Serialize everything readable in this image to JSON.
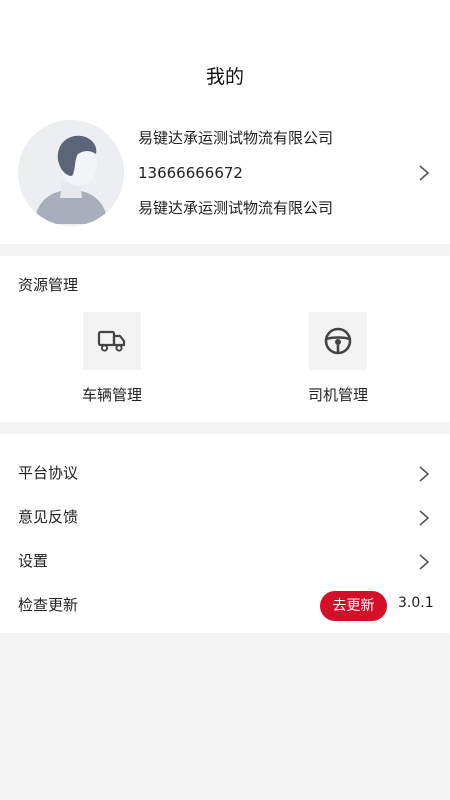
{
  "header": {
    "title": "我的"
  },
  "profile": {
    "company_name": "易键达承运测试物流有限公司",
    "phone": "13666666672",
    "company_subtitle": "易键达承运测试物流有限公司"
  },
  "resources": {
    "section_title": "资源管理",
    "items": [
      {
        "label": "车辆管理",
        "icon": "truck-icon"
      },
      {
        "label": "司机管理",
        "icon": "steering-wheel-icon"
      }
    ]
  },
  "menu": {
    "items": [
      {
        "label": "平台协议"
      },
      {
        "label": "意见反馈"
      },
      {
        "label": "设置"
      }
    ],
    "check_update": {
      "label": "检查更新",
      "button_label": "去更新",
      "version": "3.0.1"
    }
  },
  "colors": {
    "accent": "#d40f28",
    "background": "#f4f4f4",
    "card": "#ffffff"
  }
}
